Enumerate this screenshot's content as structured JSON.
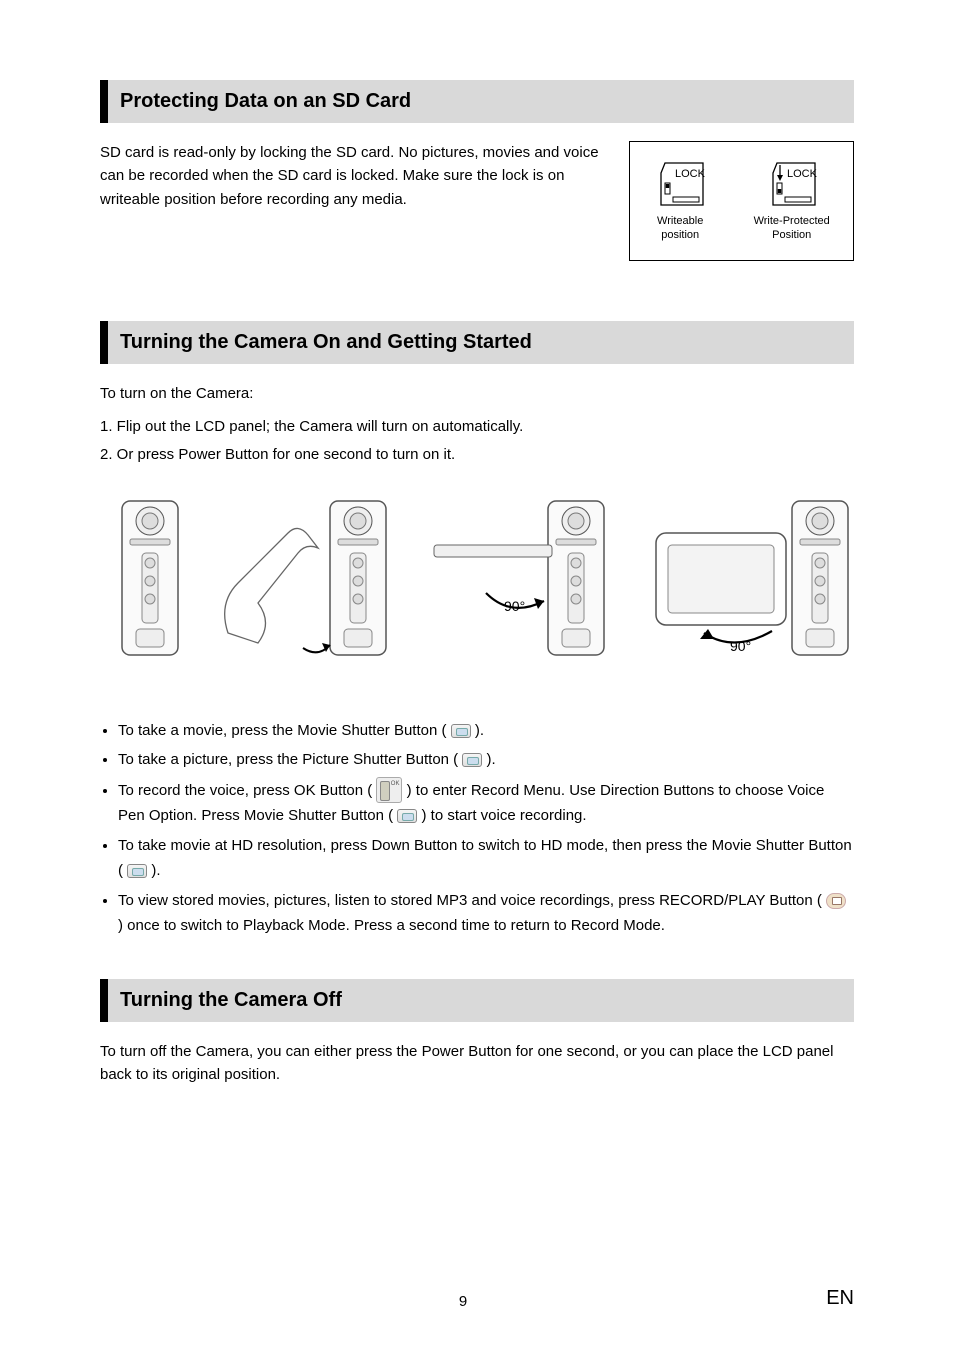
{
  "section1": {
    "heading": "Protecting Data on an SD Card",
    "paragraph": "SD card is read-only by locking the SD card. No pictures, movies and voice can be recorded when the SD card is locked. Make sure the lock is on writeable position before recording any media.",
    "diagram": {
      "lock_label_left": "LOCK",
      "lock_label_right": "LOCK",
      "caption_left_line1": "Writeable",
      "caption_left_line2": "position",
      "caption_right_line1": "Write-Protected",
      "caption_right_line2": "Position"
    }
  },
  "section2": {
    "heading": "Turning the Camera On and Getting Started",
    "intro": "To turn on the Camera:",
    "steps": {
      "s1": "1. Flip out the LCD panel; the Camera will turn on automatically.",
      "s2": "2. Or press Power Button for one second to turn on it."
    },
    "angle_label_1": "90°",
    "angle_label_2": "90°",
    "bullets": {
      "b1_pre": "To take a movie, press the Movie Shutter Button (",
      "b1_post": ").",
      "b2_pre": "To take a picture, press the Picture Shutter Button (",
      "b2_post": ").",
      "b3_pre": "To record the voice, press OK Button (",
      "b3_mid": ") to enter Record Menu. Use Direction Buttons to choose Voice Pen Option. Press Movie Shutter Button (",
      "b3_post": ") to start voice recording.",
      "b4_pre": "To take movie at HD resolution, press Down Button to switch to HD mode, then press the Movie Shutter Button (",
      "b4_post": ").",
      "b5_pre": "To view stored movies, pictures, listen to stored MP3 and voice recordings, press RECORD/PLAY Button (",
      "b5_post": ") once to switch to Playback Mode. Press a second time to return to Record Mode."
    }
  },
  "section3": {
    "heading": "Turning the Camera Off",
    "paragraph": "To turn off the Camera, you can either press the Power Button for one second, or you can place the LCD panel back to its original position."
  },
  "footer": {
    "page_number": "9",
    "lang": "EN"
  }
}
